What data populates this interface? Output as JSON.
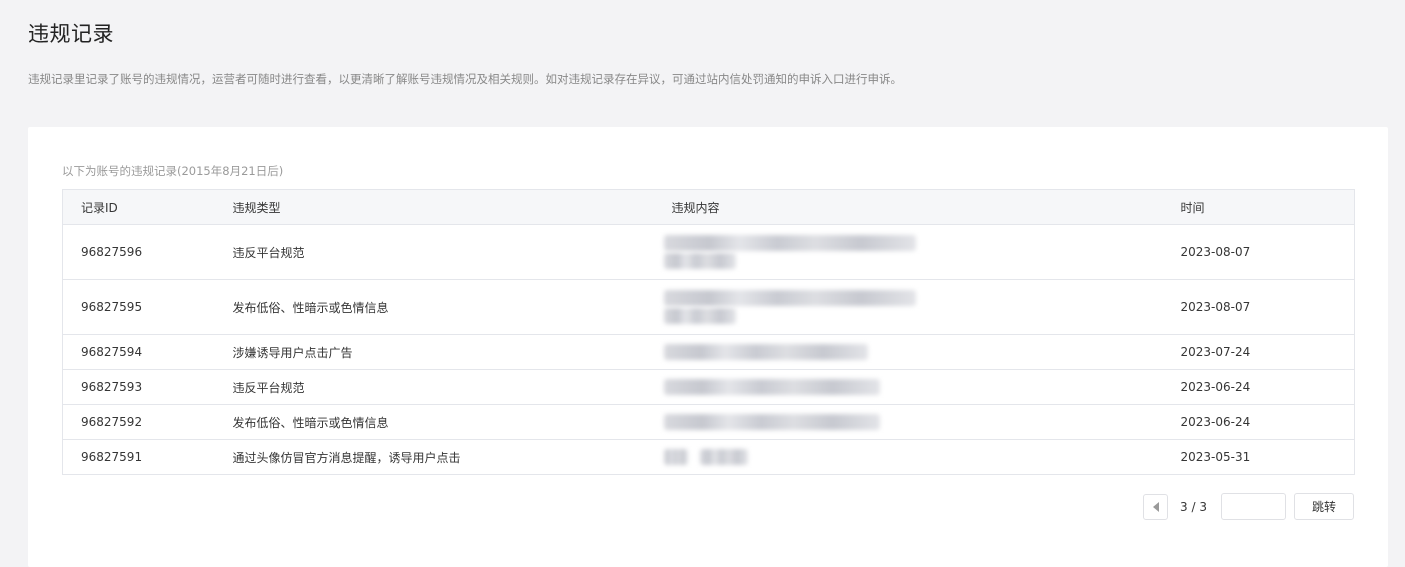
{
  "header": {
    "title": "违规记录",
    "description": "违规记录里记录了账号的违规情况，运营者可随时进行查看，以更清晰了解账号违规情况及相关规则。如对违规记录存在异议，可通过站内信处罚通知的申诉入口进行申诉。"
  },
  "records": {
    "intro": "以下为账号的违规记录(2015年8月21日后)",
    "columns": {
      "id": "记录ID",
      "type": "违规类型",
      "content": "违规内容",
      "time": "时间"
    },
    "rows": [
      {
        "id": "96827596",
        "type": "违反平台规范",
        "time": "2023-08-07",
        "content_redacted": true
      },
      {
        "id": "96827595",
        "type": "发布低俗、性暗示或色情信息",
        "time": "2023-08-07",
        "content_redacted": true
      },
      {
        "id": "96827594",
        "type": "涉嫌诱导用户点击广告",
        "time": "2023-07-24",
        "content_redacted": true
      },
      {
        "id": "96827593",
        "type": "违反平台规范",
        "time": "2023-06-24",
        "content_redacted": true
      },
      {
        "id": "96827592",
        "type": "发布低俗、性暗示或色情信息",
        "time": "2023-06-24",
        "content_redacted": true
      },
      {
        "id": "96827591",
        "type": "通过头像仿冒官方消息提醒，诱导用户点击",
        "time": "2023-05-31",
        "content_redacted": true
      }
    ]
  },
  "pager": {
    "prev_icon": "caret-left-icon",
    "info": "3 / 3",
    "input_value": "",
    "jump_label": "跳转"
  }
}
